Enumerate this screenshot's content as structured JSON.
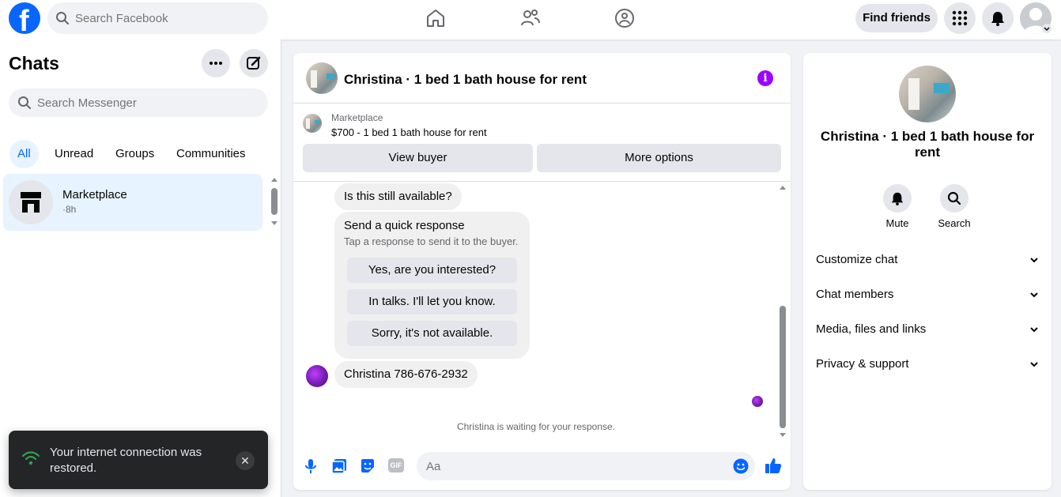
{
  "topbar": {
    "logo": "f",
    "search_placeholder": "Search Facebook",
    "find_friends": "Find friends"
  },
  "left": {
    "title": "Chats",
    "search_placeholder": "Search Messenger",
    "tabs": [
      "All",
      "Unread",
      "Groups",
      "Communities"
    ],
    "chat": {
      "name": "Marketplace",
      "time": "·8h"
    }
  },
  "toast": {
    "text": "Your internet connection was restored.",
    "close": "✕"
  },
  "conversation": {
    "title": "Christina · 1 bed 1 bath house for rent",
    "info": "i",
    "marketplace_label": "Marketplace",
    "listing": "$700 - 1 bed 1 bath house for rent",
    "view_buyer": "View buyer",
    "more_options": "More options",
    "message1": "Is this still available?",
    "quick_title": "Send a quick response",
    "quick_sub": "Tap a response to send it to the buyer.",
    "quick_responses": [
      "Yes, are you interested?",
      "In talks. I'll let you know.",
      "Sorry, it's not available."
    ],
    "message2": "Christina 786-676-2932",
    "waiting": "Christina is waiting for your response.",
    "composer_placeholder": "Aa",
    "gif_label": "GIF"
  },
  "right": {
    "name": "Christina · 1 bed 1 bath house for rent",
    "actions": [
      "Mute",
      "Search"
    ],
    "sections": [
      "Customize chat",
      "Chat members",
      "Media, files and links",
      "Privacy & support"
    ]
  },
  "colors": {
    "brand": "#0866ff",
    "info": "#9d00ff",
    "selected_bg": "#e7f3ff"
  }
}
